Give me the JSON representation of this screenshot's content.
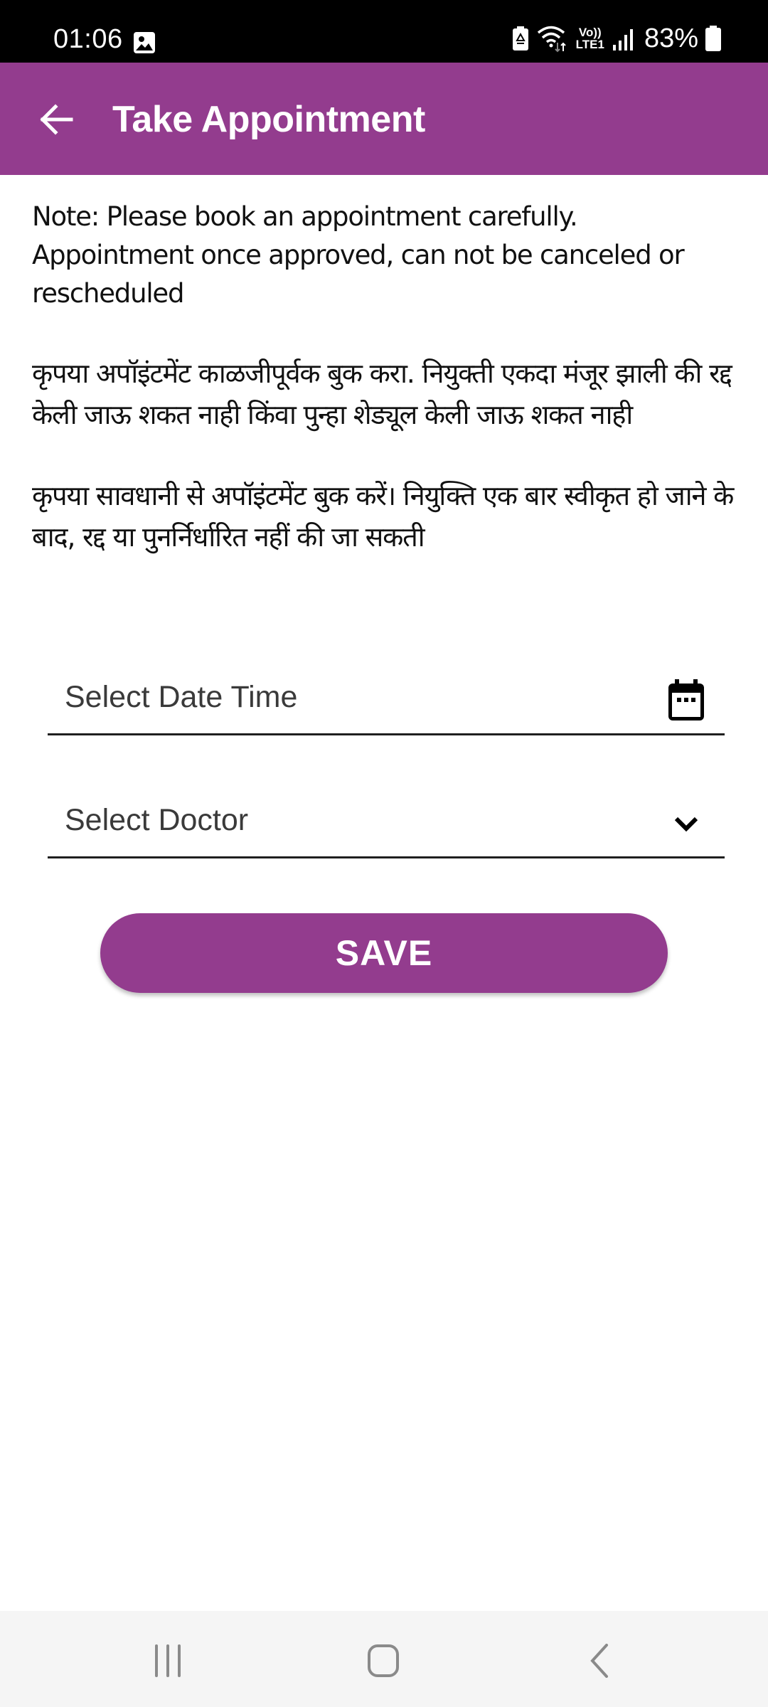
{
  "status_bar": {
    "time": "01:06",
    "network_label_top": "Vo))",
    "network_label_bottom": "LTE1",
    "battery_percent": "83%",
    "icons": [
      "gallery-icon",
      "battery-saver-icon",
      "wifi-icon",
      "volte-icon",
      "signal-icon",
      "battery-icon"
    ]
  },
  "app_bar": {
    "title": "Take Appointment",
    "back_icon": "arrow-left-icon",
    "background_color": "#933c8e"
  },
  "notes": {
    "english": "Note: Please book an appointment carefully. Appointment once approved, can not be canceled or rescheduled",
    "marathi": "कृपया अपॉइंटमेंट काळजीपूर्वक बुक करा. नियुक्ती एकदा मंजूर झाली की रद्द केली जाऊ शकत नाही किंवा पुन्हा शेड्यूल केली जाऊ शकत नाही",
    "hindi": "कृपया सावधानी से अपॉइंटमेंट बुक करें। नियुक्ति एक बार स्वीकृत हो जाने के बाद, रद्द या पुनर्निर्धारित नहीं की जा सकती"
  },
  "form": {
    "date_time": {
      "placeholder": "Select Date Time",
      "value": "",
      "icon": "calendar-icon"
    },
    "doctor": {
      "placeholder": "Select Doctor",
      "selected": "",
      "icon": "chevron-down-icon"
    },
    "save_label": "SAVE",
    "accent_color": "#933c8e"
  },
  "nav_bar": {
    "buttons": [
      "recents-icon",
      "home-icon",
      "back-icon"
    ]
  }
}
